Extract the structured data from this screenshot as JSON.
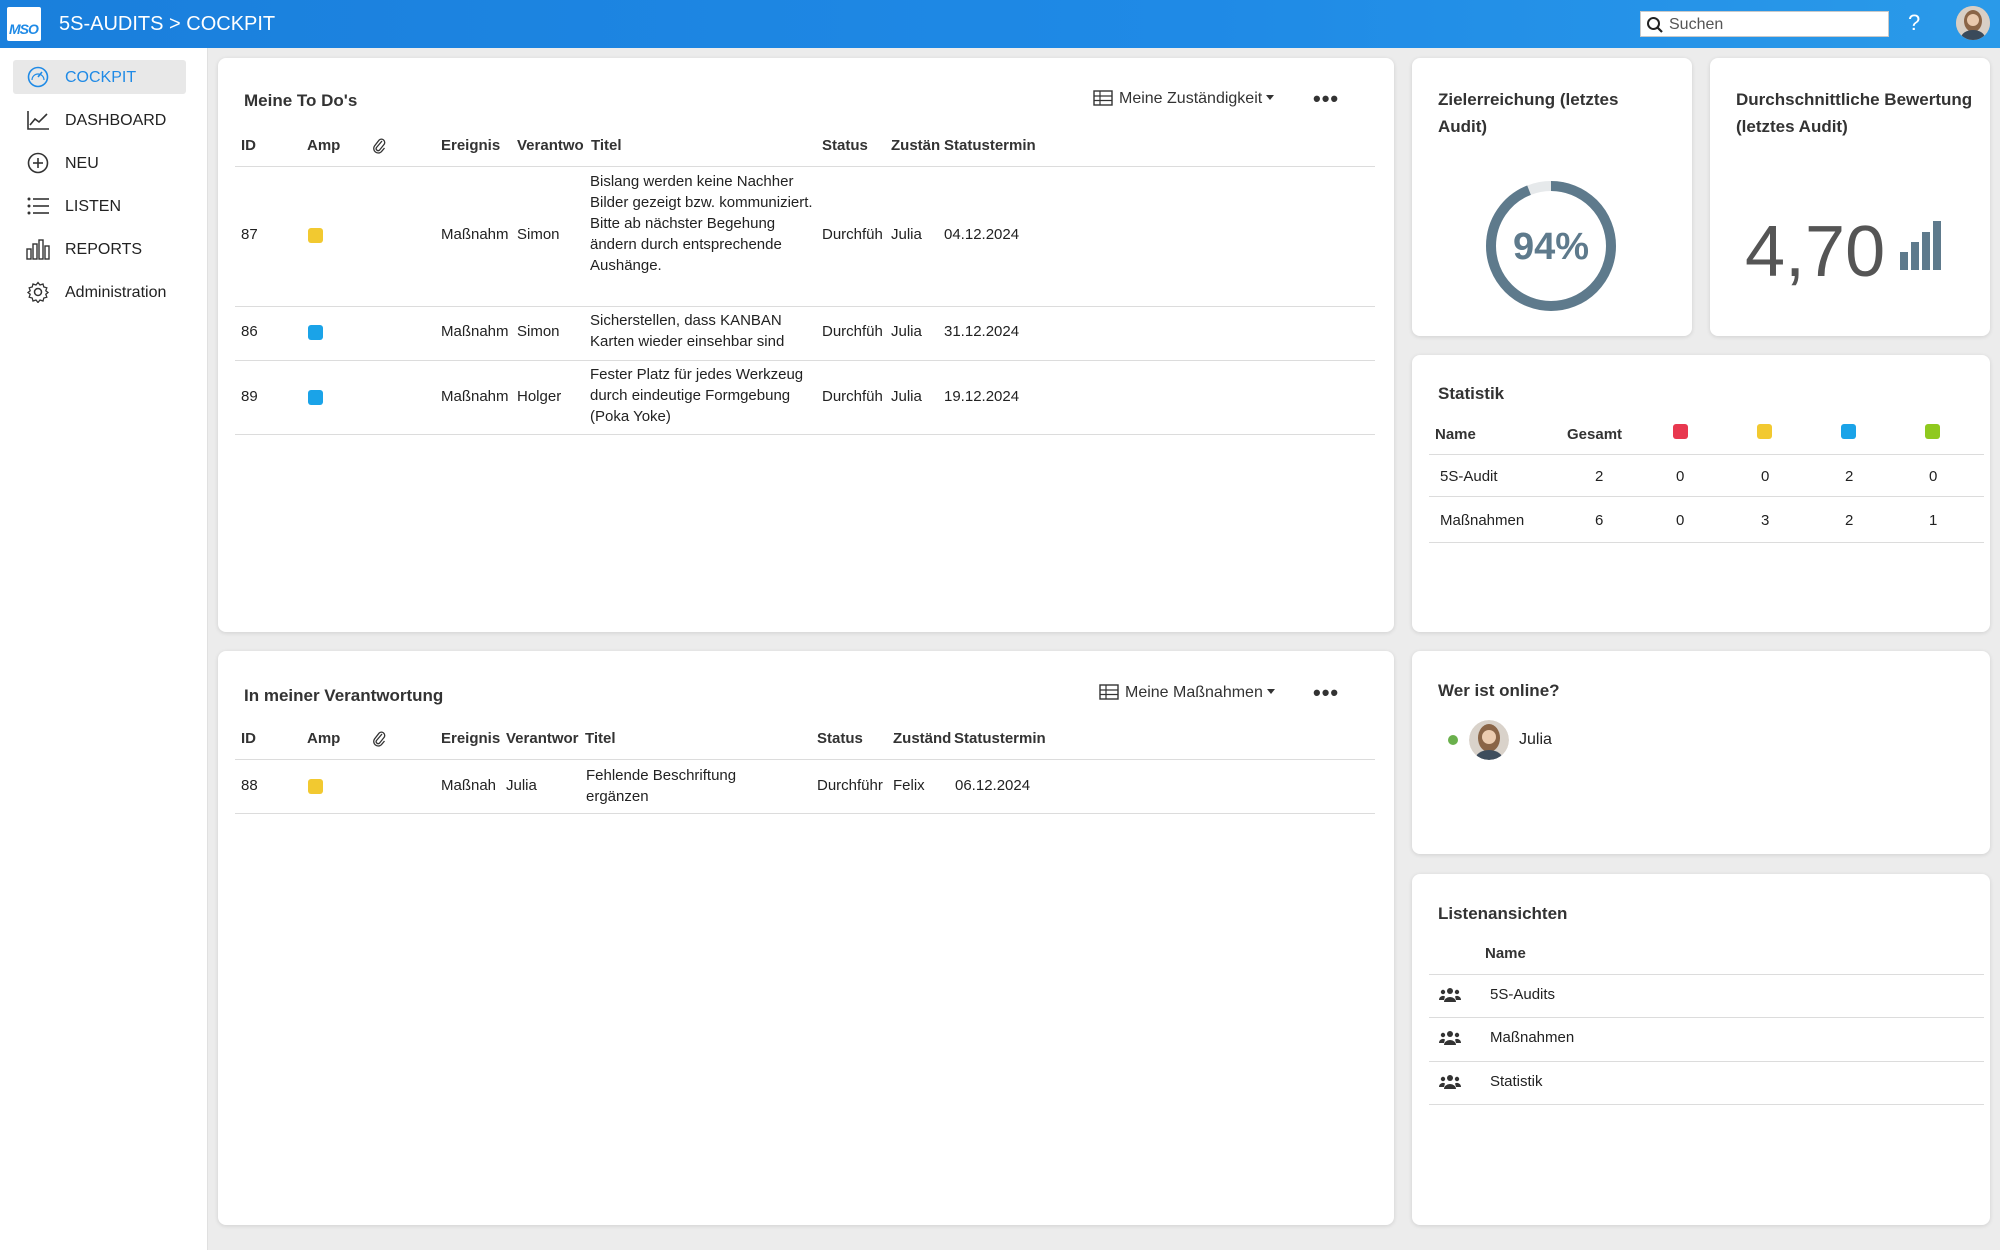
{
  "header": {
    "logo_text": "MSO",
    "title": "5S-AUDITS > COCKPIT",
    "search_placeholder": "Suchen",
    "help_label": "?"
  },
  "sidebar": {
    "items": [
      {
        "label": "COCKPIT",
        "icon": "gauge-icon",
        "active": true
      },
      {
        "label": "DASHBOARD",
        "icon": "line-chart-icon"
      },
      {
        "label": "NEU",
        "icon": "plus-circle-icon"
      },
      {
        "label": "LISTEN",
        "icon": "list-icon"
      },
      {
        "label": "REPORTS",
        "icon": "bar-chart-icon"
      },
      {
        "label": "Administration",
        "icon": "gear-icon"
      }
    ]
  },
  "colors": {
    "accent": "#1f8ae6",
    "red": "#e8384f",
    "yellow": "#f2c930",
    "blue": "#1aa3e8",
    "green": "#8fc91e",
    "gauge": "#5e7a8c",
    "online": "#6ab04c"
  },
  "todos": {
    "title": "Meine To Do's",
    "view_label": "Meine Zuständigkeit",
    "more_label": "•••",
    "columns": {
      "id": "ID",
      "amp": "Amp",
      "ereignis": "Ereignis",
      "verantwortlich": "Verantwo",
      "titel": "Titel",
      "status": "Status",
      "zustaendig": "Zustän",
      "statustermin": "Statustermin"
    },
    "rows": [
      {
        "id": "87",
        "amp": "yellow",
        "ereignis": "Maßnahm",
        "verantwortlich": "Simon",
        "titel": "Bislang werden keine Nachher Bilder gezeigt bzw. kommuniziert. Bitte ab nächster Begehung ändern durch entsprechende Aushänge.",
        "status": "Durchfüh",
        "zustaendig": "Julia",
        "statustermin": "04.12.2024"
      },
      {
        "id": "86",
        "amp": "blue",
        "ereignis": "Maßnahm",
        "verantwortlich": "Simon",
        "titel": "Sicherstellen, dass KANBAN Karten wieder einsehbar sind",
        "status": "Durchfüh",
        "zustaendig": "Julia",
        "statustermin": "31.12.2024"
      },
      {
        "id": "89",
        "amp": "blue",
        "ereignis": "Maßnahm",
        "verantwortlich": "Holger",
        "titel": "Fester Platz für jedes Werkzeug durch eindeutige Formgebung (Poka Yoke)",
        "status": "Durchfüh",
        "zustaendig": "Julia",
        "statustermin": "19.12.2024"
      }
    ]
  },
  "responsibility": {
    "title": "In meiner Verantwortung",
    "view_label": "Meine Maßnahmen",
    "more_label": "•••",
    "columns": {
      "id": "ID",
      "amp": "Amp",
      "ereignis": "Ereignis",
      "verantwortlich": "Verantwor",
      "titel": "Titel",
      "status": "Status",
      "zustaendig": "Zuständ",
      "statustermin": "Statustermin"
    },
    "rows": [
      {
        "id": "88",
        "amp": "yellow",
        "ereignis": "Maßnah",
        "verantwortlich": "Julia",
        "titel": "Fehlende Beschriftung ergänzen",
        "status": "Durchführ",
        "zustaendig": "Felix",
        "statustermin": "06.12.2024"
      }
    ]
  },
  "goal": {
    "title": "Zielerreichung (letztes Audit)",
    "value_text": "94%",
    "value": 0.94
  },
  "rating": {
    "title": "Durchschnittliche Bewertung (letztes Audit)",
    "value_text": "4,70"
  },
  "stats": {
    "title": "Statistik",
    "col_name": "Name",
    "col_total": "Gesamt",
    "rows": [
      {
        "name": "5S-Audit",
        "total": "2",
        "red": "0",
        "yellow": "0",
        "blue": "2",
        "green": "0"
      },
      {
        "name": "Maßnahmen",
        "total": "6",
        "red": "0",
        "yellow": "3",
        "blue": "2",
        "green": "1"
      }
    ]
  },
  "online": {
    "title": "Wer ist online?",
    "users": [
      {
        "name": "Julia"
      }
    ]
  },
  "lists": {
    "title": "Listenansichten",
    "col_name": "Name",
    "items": [
      "5S-Audits",
      "Maßnahmen",
      "Statistik"
    ]
  }
}
